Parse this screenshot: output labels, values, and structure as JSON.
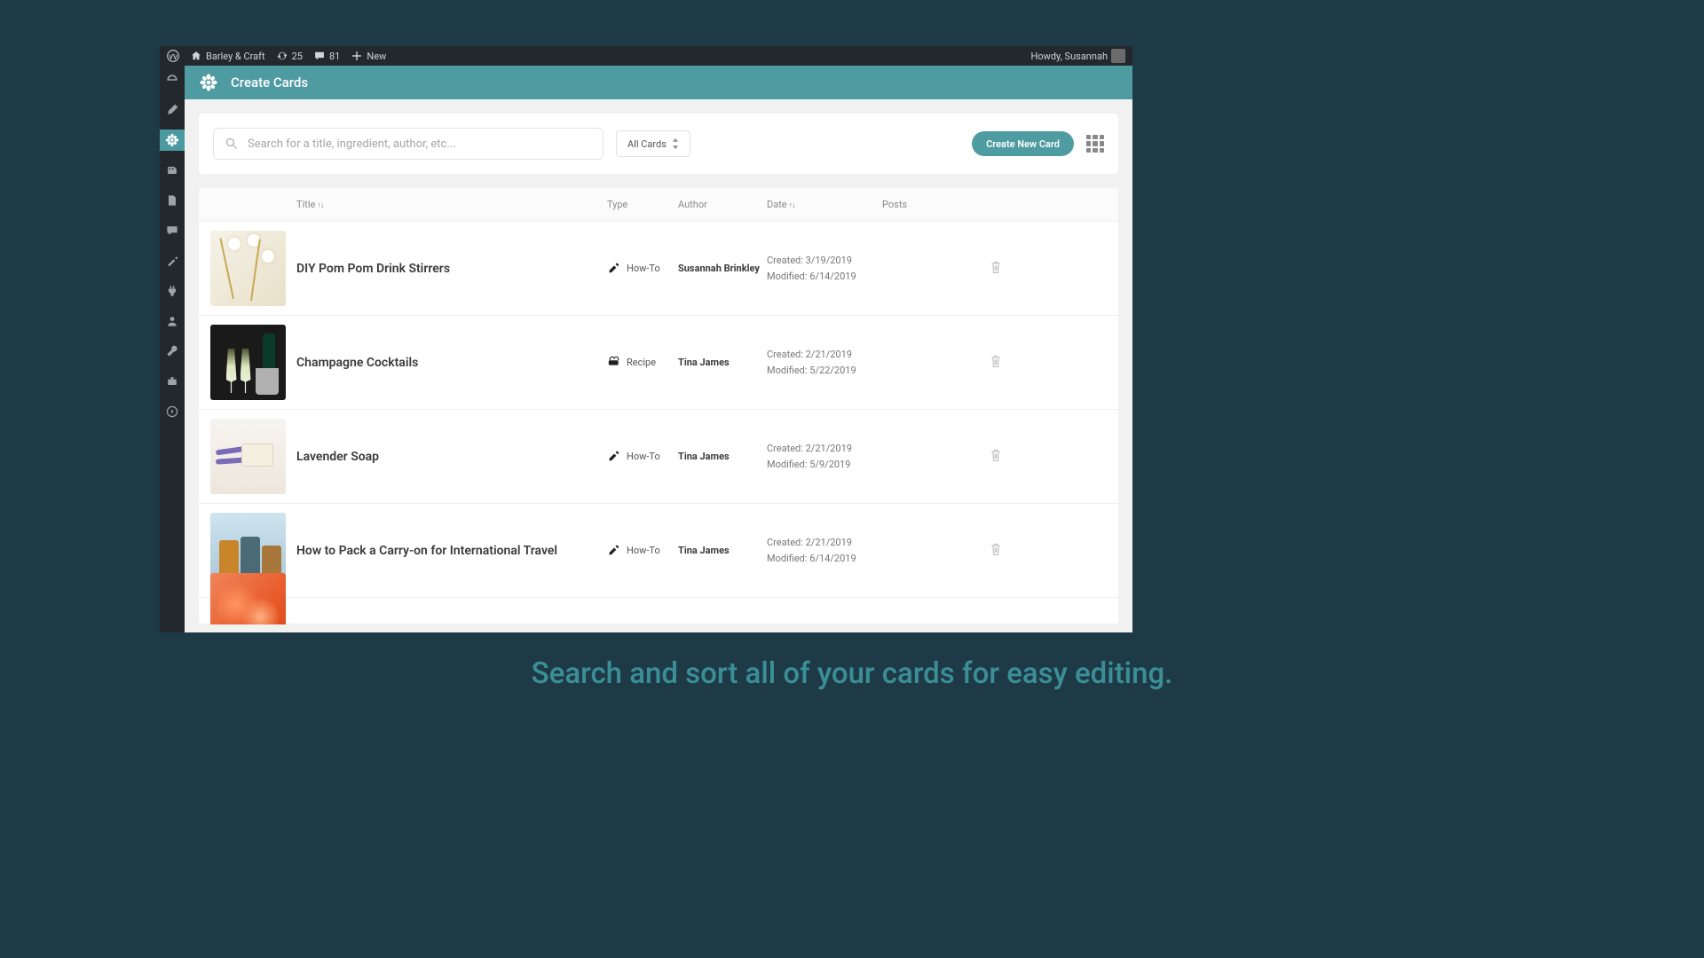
{
  "wpbar": {
    "site_name": "Barley & Craft",
    "updates": "25",
    "comments": "81",
    "new": "New",
    "howdy": "Howdy, Susannah"
  },
  "header": {
    "title": "Create Cards"
  },
  "search": {
    "placeholder": "Search for a title, ingredient, author, etc..."
  },
  "filter": {
    "label": "All Cards"
  },
  "create_btn": "Create New Card",
  "columns": {
    "title": "Title",
    "type": "Type",
    "author": "Author",
    "date": "Date",
    "posts": "Posts"
  },
  "rows": [
    {
      "title": "DIY Pom Pom Drink Stirrers",
      "type": "How-To",
      "type_key": "howto",
      "author": "Susannah Brinkley",
      "created": "Created: 3/19/2019",
      "modified": "Modified: 6/14/2019",
      "thumb": "pom"
    },
    {
      "title": "Champagne Cocktails",
      "type": "Recipe",
      "type_key": "recipe",
      "author": "Tina James",
      "created": "Created: 2/21/2019",
      "modified": "Modified: 5/22/2019",
      "thumb": "ch"
    },
    {
      "title": "Lavender Soap",
      "type": "How-To",
      "type_key": "howto",
      "author": "Tina James",
      "created": "Created: 2/21/2019",
      "modified": "Modified: 5/9/2019",
      "thumb": "lav"
    },
    {
      "title": "How to Pack a Carry-on for International Travel",
      "type": "How-To",
      "type_key": "howto",
      "author": "Tina James",
      "created": "Created: 2/21/2019",
      "modified": "Modified: 6/14/2019",
      "thumb": "lug"
    },
    {
      "title": "",
      "type": "",
      "type_key": "",
      "author": "",
      "created": "",
      "modified": "",
      "thumb": "food",
      "partial": true
    }
  ],
  "caption": "Search and sort all of your cards for easy editing."
}
